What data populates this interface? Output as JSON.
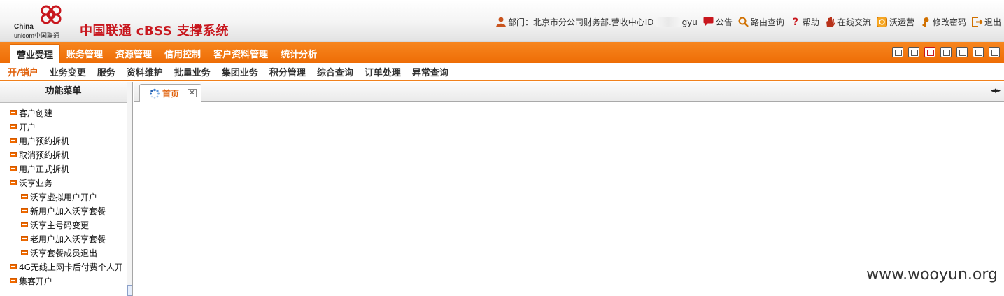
{
  "header": {
    "logo_text_line1": "China",
    "logo_text_line2": "unicom中国联通",
    "system_title": "中国联通 cBSS 支撑系统",
    "dept_label": "部门：北京市分公司财务部.营收中心ID",
    "user_suffix": "gyu",
    "links": [
      {
        "label": "公告",
        "icon": "announcement-icon"
      },
      {
        "label": "路由查询",
        "icon": "search-icon"
      },
      {
        "label": "帮助",
        "icon": "help-icon"
      },
      {
        "label": "在线交流",
        "icon": "hand-icon"
      },
      {
        "label": "沃运营",
        "icon": "wo-icon"
      },
      {
        "label": "修改密码",
        "icon": "key-icon"
      },
      {
        "label": "退出",
        "icon": "logout-icon"
      }
    ]
  },
  "main_nav": {
    "tabs": [
      "营业受理",
      "账务管理",
      "资源管理",
      "信用控制",
      "客户资料管理",
      "统计分析"
    ],
    "active": 0
  },
  "sub_nav": {
    "tabs": [
      "开/销户",
      "业务变更",
      "服务",
      "资料维护",
      "批量业务",
      "集团业务",
      "积分管理",
      "综合查询",
      "订单处理",
      "异常查询"
    ],
    "active": 0
  },
  "left_menu": {
    "title": "功能菜单",
    "items": [
      {
        "label": "客户创建",
        "level": 0
      },
      {
        "label": "开户",
        "level": 0
      },
      {
        "label": "用户预约拆机",
        "level": 0
      },
      {
        "label": "取消预约拆机",
        "level": 0
      },
      {
        "label": "用户正式拆机",
        "level": 0
      },
      {
        "label": "沃享业务",
        "level": 0
      },
      {
        "label": "沃享虚拟用户开户",
        "level": 1
      },
      {
        "label": "新用户加入沃享套餐",
        "level": 1
      },
      {
        "label": "沃享主号码变更",
        "level": 1
      },
      {
        "label": "老用户加入沃享套餐",
        "level": 1
      },
      {
        "label": "沃享套餐成员退出",
        "level": 1
      },
      {
        "label": "4G无线上网卡后付费个人开",
        "level": 0
      },
      {
        "label": "集客开户",
        "level": 0
      }
    ]
  },
  "content_tabs": {
    "tabs": [
      {
        "label": "首页"
      }
    ],
    "close_glyph": "×",
    "scroll_glyph": "◂◆▸"
  },
  "watermark": "www.wooyun.org",
  "colors": {
    "brand_red": "#c8161d",
    "nav_orange": "#f07a14",
    "active_text": "#e0600a"
  }
}
